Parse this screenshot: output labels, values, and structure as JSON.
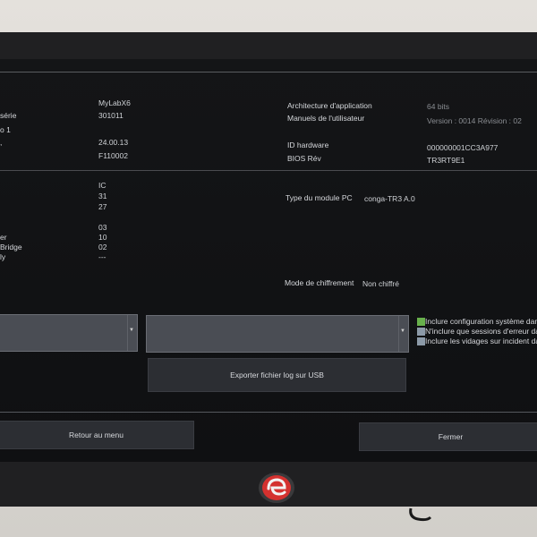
{
  "header_fields": {
    "left": [
      {
        "label": "",
        "value": "MyLabX6"
      },
      {
        "label": "série",
        "value": "301011"
      },
      {
        "label": "o 1",
        "value": ""
      },
      {
        "label": "",
        "value": "24.00.13"
      },
      {
        "label": "",
        "value": "F110002"
      }
    ],
    "right": [
      {
        "label": "Architecture d'application",
        "value": "64 bits"
      },
      {
        "label": "Manuels de l'utilisateur",
        "value": "Version : 0014   Révision : 02"
      },
      {
        "label": "ID hardware",
        "value": "000000001CC3A977"
      },
      {
        "label": "BIOS Rév",
        "value": "TR3RT9E1"
      }
    ]
  },
  "hw_fields": {
    "left": [
      {
        "label": "",
        "value": "IC"
      },
      {
        "label": "",
        "value": "31"
      },
      {
        "label": "",
        "value": "27"
      },
      {
        "label": "",
        "value": "03"
      },
      {
        "label": "er",
        "value": "10"
      },
      {
        "label": "Bridge",
        "value": "02"
      },
      {
        "label": "ly",
        "value": "---"
      }
    ],
    "pc_module": {
      "label": "Type du module PC",
      "value": "conga-TR3 A.0"
    },
    "encryption": {
      "label": "Mode de chiffrement",
      "value": "Non chiffré"
    }
  },
  "log_options": {
    "checkboxes": [
      {
        "label": "Inclure configuration système dans",
        "checked": true
      },
      {
        "label": "N'inclure que sessions d'erreur dan",
        "checked": false
      },
      {
        "label": "Inclure les vidages sur incident dan",
        "checked": false
      }
    ],
    "export_label": "Exporter fichier log sur USB"
  },
  "footer": {
    "back_label": "Retour au menu",
    "close_label": "Fermer"
  },
  "colors": {
    "screen_bg": "#121315",
    "text": "#d6d8dc",
    "accent_green": "#68b04c",
    "logo_red": "#d4312f"
  },
  "icons": {
    "logo": "esaote-logo-icon",
    "dropdown": "dropdown-arrow-icon"
  }
}
